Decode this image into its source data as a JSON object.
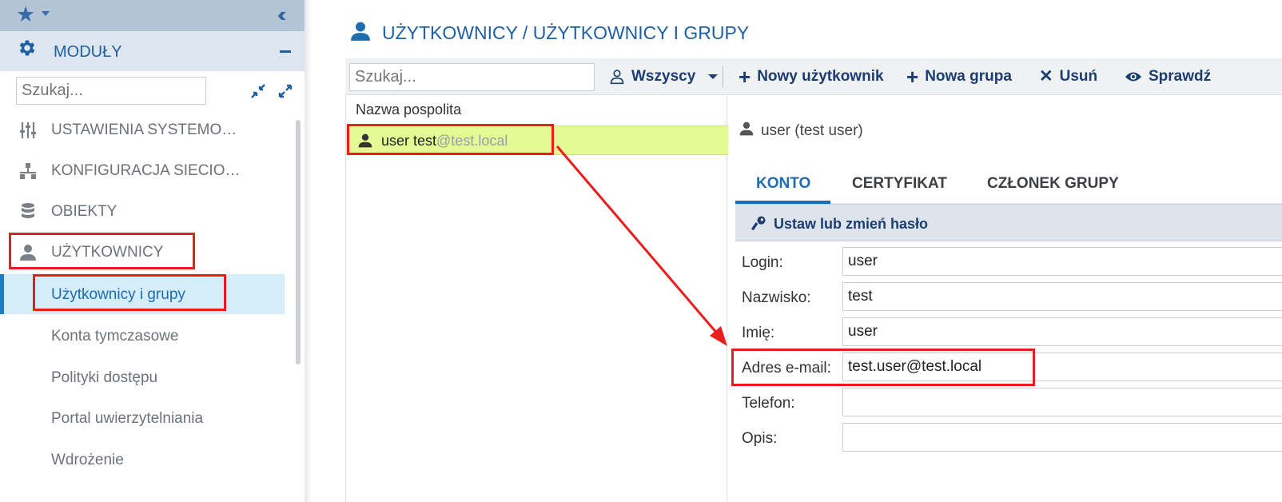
{
  "sidebar": {
    "modules_label": "MODUŁY",
    "search_placeholder": "Szukaj...",
    "items": [
      {
        "label": "USTAWIENIA SYSTEMO…"
      },
      {
        "label": "KONFIGURACJA SIECIO…"
      },
      {
        "label": "OBIEKTY"
      },
      {
        "label": "UŻYTKOWNICY"
      }
    ],
    "subitems": [
      {
        "label": "Użytkownicy i grupy"
      },
      {
        "label": "Konta tymczasowe"
      },
      {
        "label": "Polityki dostępu"
      },
      {
        "label": "Portal uwierzytelniania"
      },
      {
        "label": "Wdrożenie"
      }
    ]
  },
  "main": {
    "title": "UŻYTKOWNICY / UŻYTKOWNICY I GRUPY",
    "toolbar": {
      "search_placeholder": "Szukaj...",
      "filter_label": "Wszyscy",
      "new_user": "Nowy użytkownik",
      "new_group": "Nowa grupa",
      "delete": "Usuń",
      "check": "Sprawdź"
    },
    "list": {
      "header": "Nazwa pospolita",
      "rows": [
        {
          "name": "user test",
          "domain": "@test.local"
        }
      ]
    },
    "detail": {
      "heading": "user (test user)",
      "tabs": [
        "KONTO",
        "CERTYFIKAT",
        "CZŁONEK GRUPY"
      ],
      "password_action": "Ustaw lub zmień hasło",
      "fields": [
        {
          "label": "Login:",
          "value": "user"
        },
        {
          "label": "Nazwisko:",
          "value": "test"
        },
        {
          "label": "Imię:",
          "value": "user"
        },
        {
          "label": "Adres e-mail:",
          "value": "test.user@test.local"
        },
        {
          "label": "Telefon:",
          "value": ""
        },
        {
          "label": "Opis:",
          "value": ""
        }
      ]
    }
  },
  "colors": {
    "accent": "#1f6cb0",
    "highlight_row": "#e3fb95",
    "annotation_red": "#ea1c1c"
  }
}
